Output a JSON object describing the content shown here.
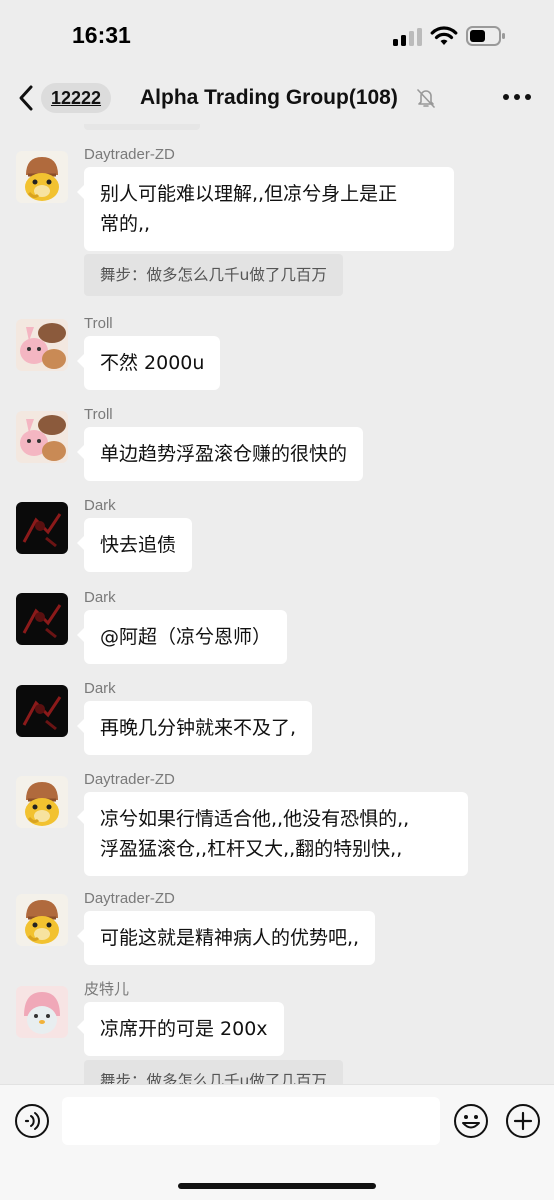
{
  "status_bar": {
    "time": "16:31",
    "icons": [
      "cellular-signal-icon",
      "wifi-icon",
      "battery-icon"
    ]
  },
  "nav": {
    "back_icon": "chevron-left-icon",
    "unread_count": "12222",
    "title": "Alpha Trading Group(108)",
    "mute_icon": "bell-slash-icon",
    "more_icon": "more-dots-icon"
  },
  "messages": [
    {
      "sender": "Daytrader-ZD",
      "text": "别人可能难以理解,,但凉兮身上是正\n常的,,",
      "quote": "舞步：做多怎么几千u做了几百万",
      "avatar": "duck-avatar"
    },
    {
      "sender": "Troll",
      "text": "不然 2000u",
      "avatar": "bunny-avatar"
    },
    {
      "sender": "Troll",
      "text": "单边趋势浮盈滚仓赚的很快的",
      "avatar": "bunny-avatar"
    },
    {
      "sender": "Dark",
      "text": "快去追债",
      "avatar": "dark-avatar"
    },
    {
      "sender": "Dark",
      "text": "@阿超（凉兮恩师）",
      "avatar": "dark-avatar"
    },
    {
      "sender": "Dark",
      "text": "再晚几分钟就来不及了,",
      "avatar": "dark-avatar"
    },
    {
      "sender": "Daytrader-ZD",
      "text": "凉兮如果行情适合他,,他没有恐惧的,,\n浮盈猛滚仓,,杠杆又大,,翻的特别快,,",
      "avatar": "duck-avatar"
    },
    {
      "sender": "Daytrader-ZD",
      "text": "可能这就是精神病人的优势吧,,",
      "avatar": "duck-avatar"
    },
    {
      "sender": "皮特儿",
      "text": "凉席开的可是 200x",
      "quote": "舞步：做多怎么几千u做了几百万",
      "avatar": "penguin-avatar"
    }
  ],
  "input_bar": {
    "voice_icon": "voice-icon",
    "input_value": "",
    "emoji_icon": "emoji-icon",
    "plus_icon": "plus-circle-icon"
  },
  "colors": {
    "background": "#ededed",
    "bubble": "#ffffff",
    "quote_bg": "#e3e3e3",
    "sender_text": "#7a7a7a",
    "input_bar_bg": "#f7f7f7"
  }
}
